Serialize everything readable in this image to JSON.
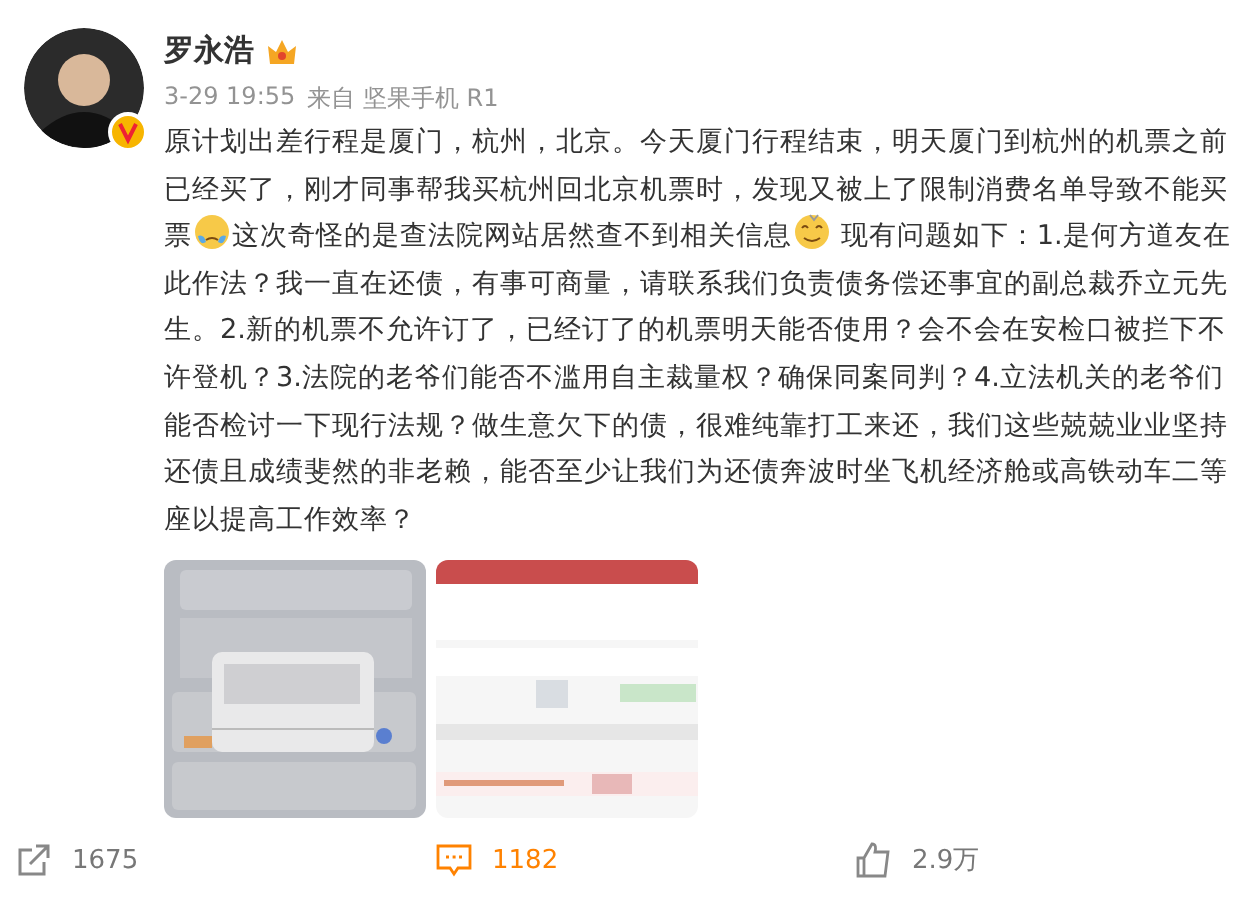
{
  "author": {
    "name": "罗永浩",
    "verified": true
  },
  "meta": {
    "time": "3-29 19:55",
    "source": "来自 坚果手机 R1"
  },
  "body": [
    {
      "kind": "text",
      "text": "原计划出差行程是厦门，杭州，北京。今天厦门行程结束，明天厦门到杭州的机票之前已经买了，刚才同事帮我买杭州回北京机票时，发现又被上了限制消费名单导致不能买票"
    },
    {
      "kind": "emoji"
    },
    {
      "kind": "text",
      "text": "这次奇怪的是查法院网站居然查不到相关信息"
    },
    {
      "kind": "emoji"
    },
    {
      "kind": "text",
      "text": " 现有问题如下：1.是何方道友在此作法？我一直在还债，有事可商量，请联系我们负责债务偿还事宜的副总裁乔立元先生。2.新的机票不允许订了，已经订了的机票明天能否使用？会不会在安检口被拦下不许登机？3.法院的老爷们能否不滥用自主裁量权？确保同案同判？4.立法机关的老爷们能否检讨一下现行法规？做生意欠下的债，很难纯靠打工来还，我们这些兢兢业业坚持还债且成绩斐然的非老赖，能否至少让我们为还债奔波时坐飞机经济舱或高铁动车二等座以提高工作效率？"
    }
  ],
  "actions": [
    {
      "kind": "repost",
      "count": "1675",
      "active": false
    },
    {
      "kind": "comment",
      "count": "1182",
      "active": true
    },
    {
      "kind": "like",
      "count": "2.9万",
      "active": false
    }
  ]
}
